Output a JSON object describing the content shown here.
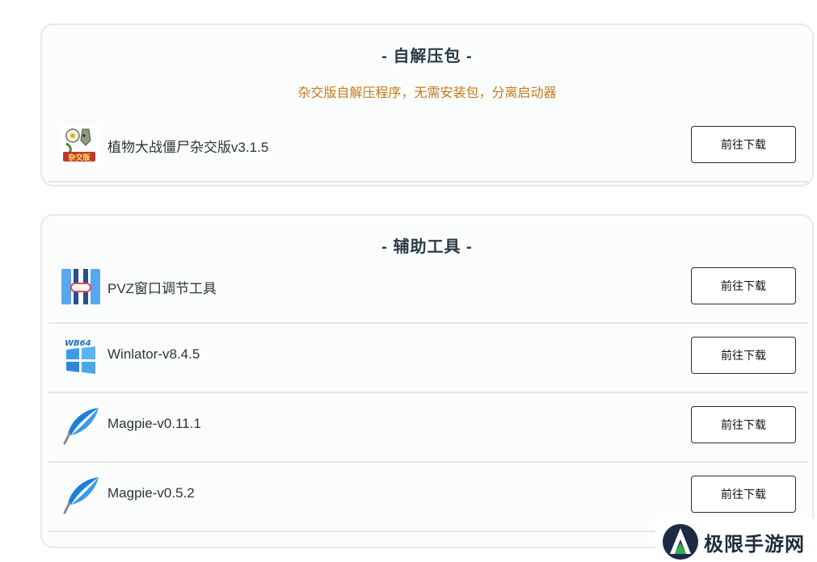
{
  "sections": [
    {
      "title": "- 自解压包 -",
      "subtitle": "杂交版自解压程序，无需安装包，分离启动器",
      "items": [
        {
          "name": "植物大战僵尸杂交版v3.1.5",
          "icon": "pvz-hybrid-icon",
          "button": "前往下载"
        }
      ]
    },
    {
      "title": "- 辅助工具 -",
      "items": [
        {
          "name": "PVZ窗口调节工具",
          "icon": "pvz-window-tool-icon",
          "button": "前往下载"
        },
        {
          "name": "Winlator-v8.4.5",
          "icon": "winlator-icon",
          "button": "前往下载"
        },
        {
          "name": "Magpie-v0.11.1",
          "icon": "magpie-feather-icon",
          "button": "前往下载"
        },
        {
          "name": "Magpie-v0.5.2",
          "icon": "magpie-feather-icon",
          "button": "前往下载"
        }
      ]
    }
  ],
  "watermark": {
    "text": "极限手游网",
    "icon": "jixian-logo-icon"
  },
  "colors": {
    "subtitle": "#c47a1a",
    "title": "#2b3a45",
    "card_border": "#e6eaea",
    "magpie_blue": "#1e7fd8"
  }
}
